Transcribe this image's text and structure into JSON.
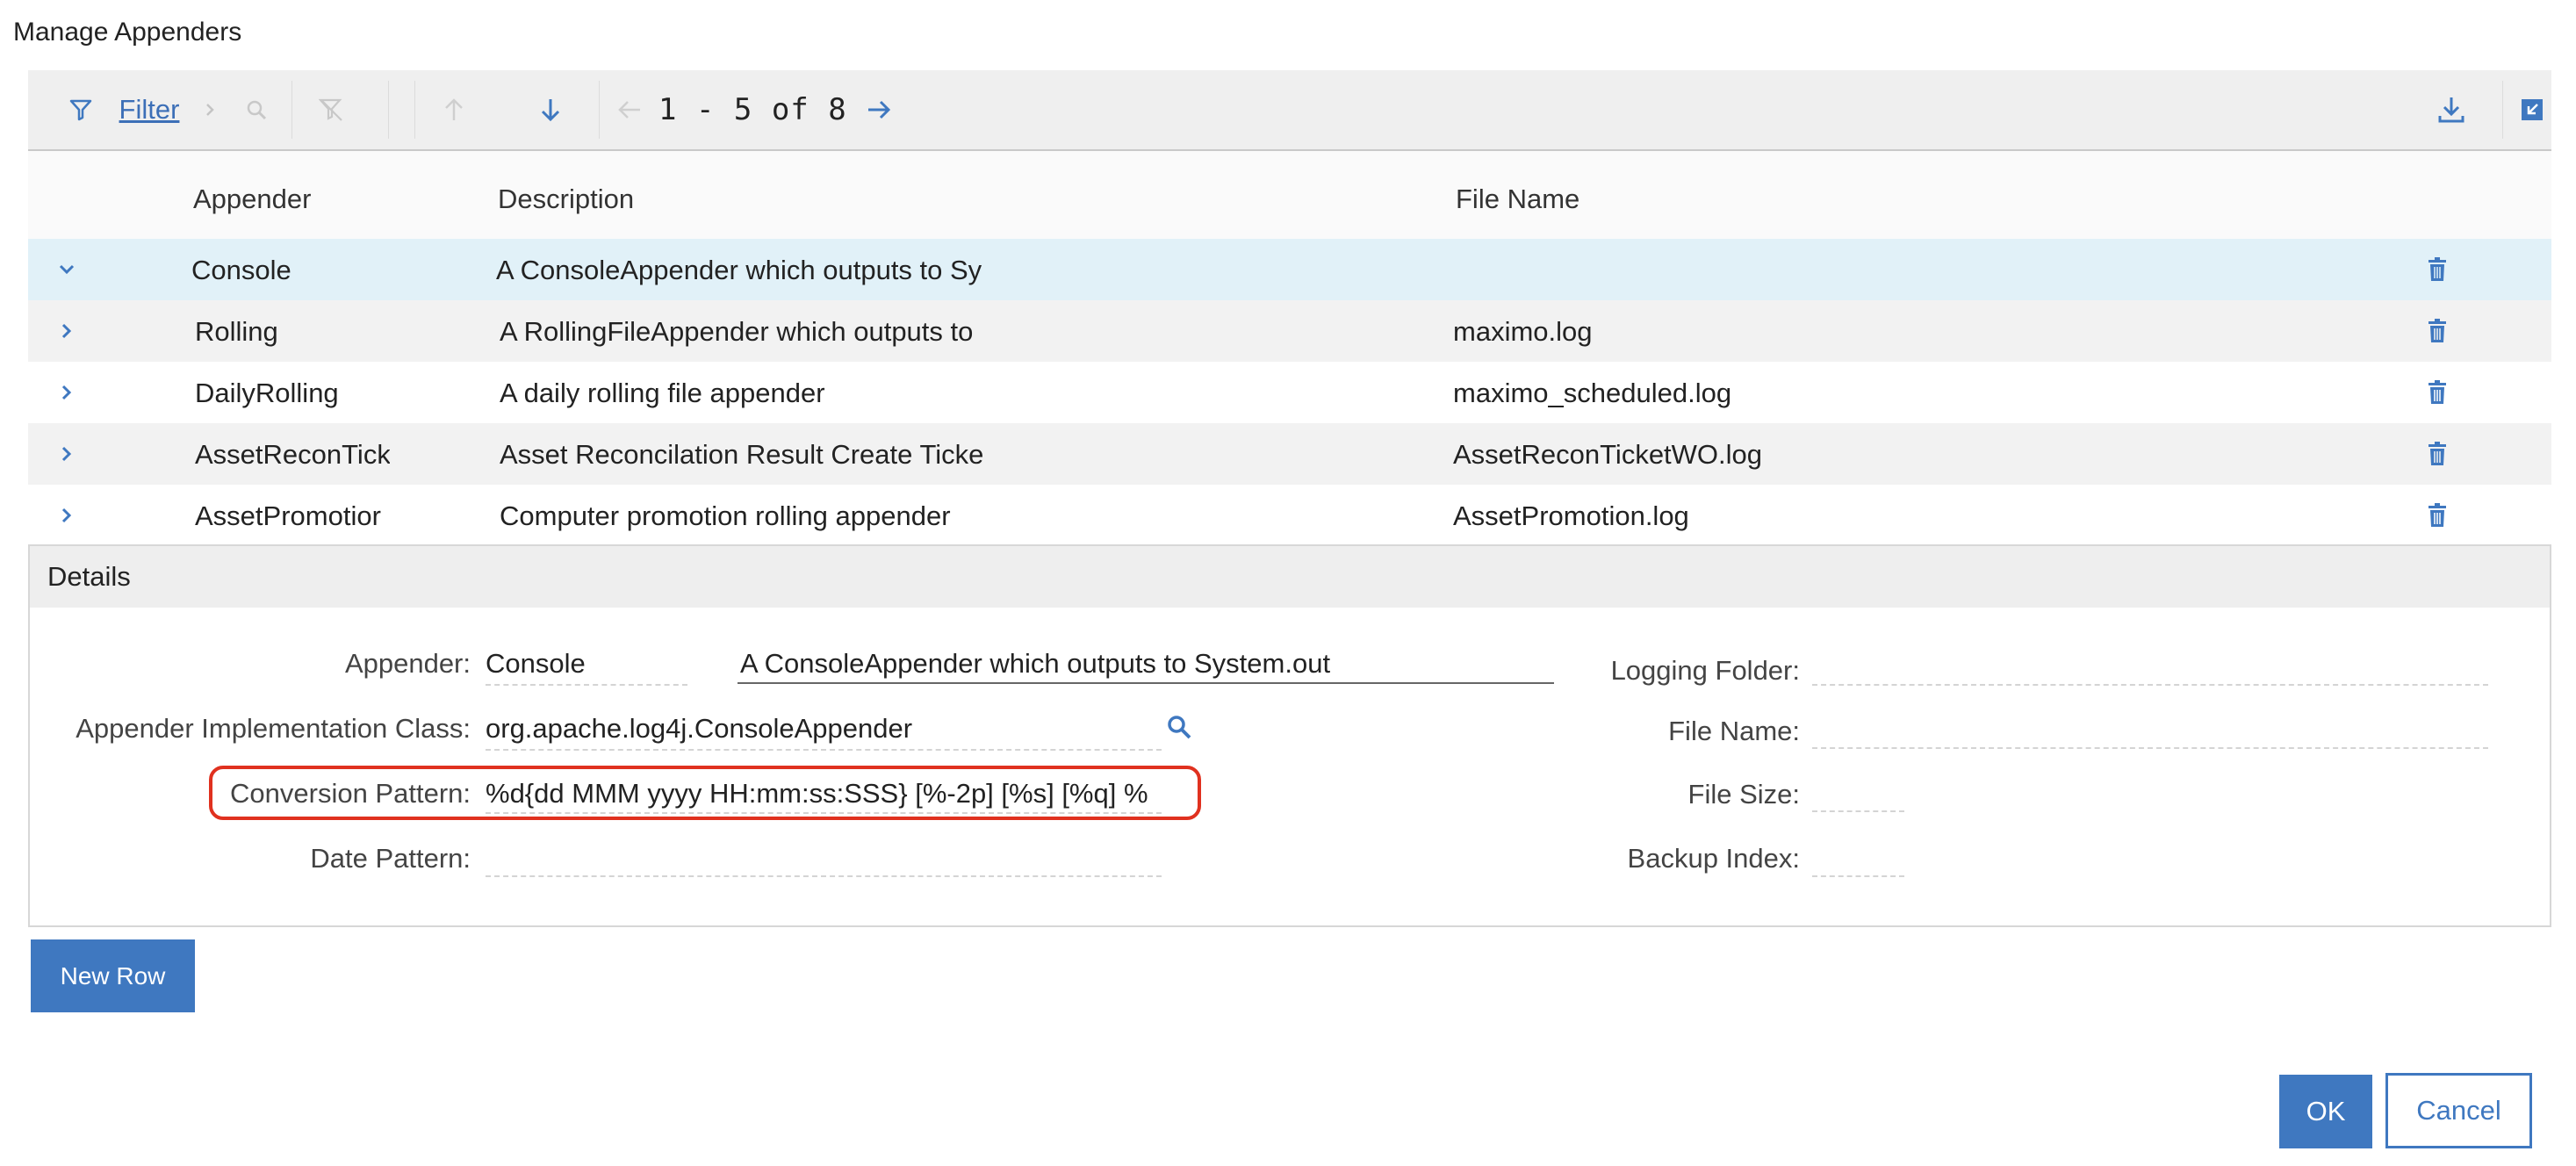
{
  "dialog": {
    "title": "Manage Appenders"
  },
  "toolbar": {
    "filter_label": "Filter",
    "pager_text": "1 - 5 of 8"
  },
  "table": {
    "columns": [
      "Appender",
      "Description",
      "File Name"
    ],
    "rows": [
      {
        "appender": "Console",
        "description": "A ConsoleAppender which outputs to Sy",
        "file_name": "",
        "expanded": true
      },
      {
        "appender": "Rolling",
        "description": "A RollingFileAppender which outputs to",
        "file_name": "maximo.log",
        "expanded": false
      },
      {
        "appender": "DailyRolling",
        "description": "A daily rolling file appender",
        "file_name": "maximo_scheduled.log",
        "expanded": false
      },
      {
        "appender": "AssetReconTick",
        "description": "Asset Reconcilation Result Create Ticke",
        "file_name": "AssetReconTicketWO.log",
        "expanded": false
      },
      {
        "appender": "AssetPromotior",
        "description": "Computer promotion rolling appender",
        "file_name": "AssetPromotion.log",
        "expanded": false
      }
    ]
  },
  "details": {
    "title": "Details",
    "appender_label": "Appender:",
    "appender_value": "Console",
    "appender_description": "A ConsoleAppender which outputs to System.out",
    "impl_class_label": "Appender Implementation Class:",
    "impl_class_value": "org.apache.log4j.ConsoleAppender",
    "conversion_pattern_label": "Conversion Pattern:",
    "conversion_pattern_value": "%d{dd MMM yyyy HH:mm:ss:SSS} [%-2p] [%s] [%q] %",
    "date_pattern_label": "Date Pattern:",
    "date_pattern_value": "",
    "logging_folder_label": "Logging Folder:",
    "logging_folder_value": "",
    "file_name_label": "File Name:",
    "file_name_value": "",
    "file_size_label": "File Size:",
    "file_size_value": "",
    "backup_index_label": "Backup Index:",
    "backup_index_value": ""
  },
  "buttons": {
    "new_row": "New Row",
    "ok": "OK",
    "cancel": "Cancel"
  },
  "colors": {
    "accent": "#3f78c0",
    "selected_row": "#e1f1f8",
    "highlight": "#e0311f"
  }
}
